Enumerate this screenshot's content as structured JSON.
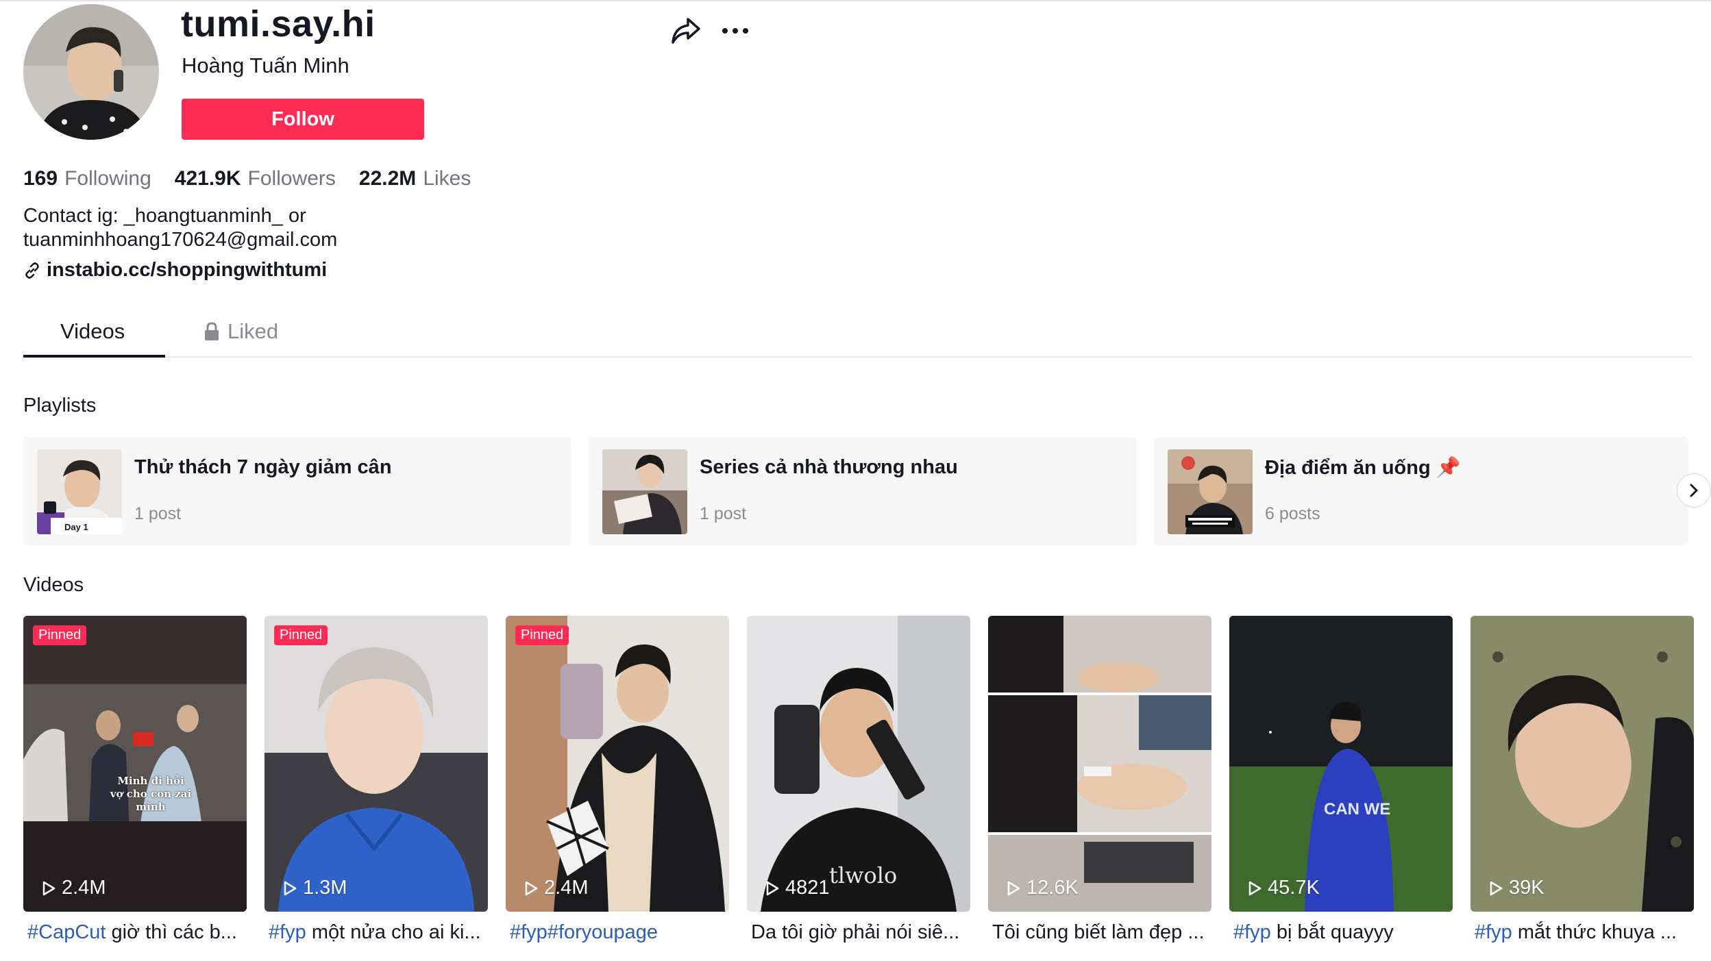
{
  "profile": {
    "username": "tumi.say.hi",
    "display_name": "Hoàng Tuấn Minh",
    "follow_label": "Follow",
    "stats": [
      {
        "value": "169",
        "label": "Following"
      },
      {
        "value": "421.9K",
        "label": "Followers"
      },
      {
        "value": "22.2M",
        "label": "Likes"
      }
    ],
    "bio_line1": "Contact ig: _hoangtuanminh_ or",
    "bio_line2": "tuanminhhoang170624@gmail.com",
    "link": "instabio.cc/shoppingwithtumi"
  },
  "tabs": {
    "videos": "Videos",
    "liked": "Liked"
  },
  "sections": {
    "playlists": "Playlists",
    "videos": "Videos"
  },
  "playlists": [
    {
      "title": "Thử thách 7 ngày giảm cân",
      "count": "1 post",
      "thumb_text": "Day 1"
    },
    {
      "title": "Series cả nhà thương nhau",
      "count": "1 post"
    },
    {
      "title": "Địa điểm ăn uống 📌",
      "count": "6 posts"
    }
  ],
  "videos": [
    {
      "pinned": "Pinned",
      "views": "2.4M",
      "tag": "#CapCut",
      "caption": " giờ thì các b...",
      "overlay": "Minh đi hỏi vợ cho con zai mình"
    },
    {
      "pinned": "Pinned",
      "views": "1.3M",
      "tag": "#fyp",
      "caption": " một nửa cho ai ki..."
    },
    {
      "pinned": "Pinned",
      "views": "2.4M",
      "tag": "#fyp#foryoupage",
      "caption": ""
    },
    {
      "views": "4821",
      "tag": "",
      "caption": "Da tôi giờ phải nói siê..."
    },
    {
      "views": "12.6K",
      "tag": "",
      "caption": "Tôi cũng biết làm đẹp ..."
    },
    {
      "views": "45.7K",
      "tag": "#fyp",
      "caption": " bị bắt quayyy"
    },
    {
      "views": "39K",
      "tag": "#fyp",
      "caption": " mắt thức khuya ..."
    }
  ],
  "colors": {
    "accent": "#fe2c55",
    "hashtag": "#2b5db9",
    "muted": "#73747b"
  }
}
